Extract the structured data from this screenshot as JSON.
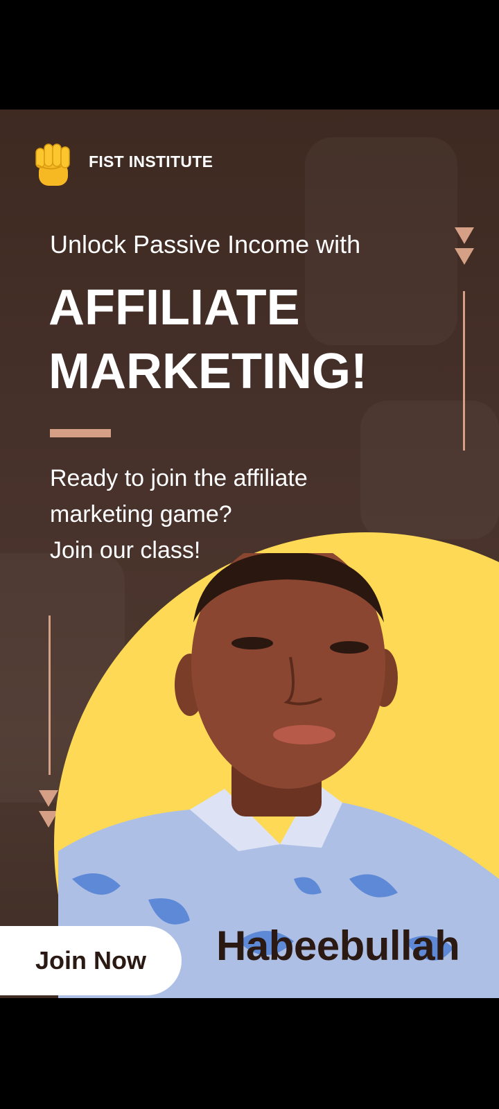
{
  "brand": {
    "name": "FIST INSTITUTE",
    "logo_icon": "raised-fist-icon"
  },
  "hero": {
    "subtitle": "Unlock Passive Income with",
    "headline_line1": "AFFILIATE",
    "headline_line2": "MARKETING!",
    "body_line1": "Ready to join the affiliate",
    "body_line2": "marketing game?",
    "body_line3": "Join our class!"
  },
  "cta": {
    "label": "Join Now"
  },
  "person": {
    "name": "Habeebullah"
  },
  "colors": {
    "background": "#3e2a21",
    "accent": "#d6a086",
    "blob": "#fdd955",
    "text_light": "#ffffff",
    "text_dark": "#2b1a14"
  }
}
